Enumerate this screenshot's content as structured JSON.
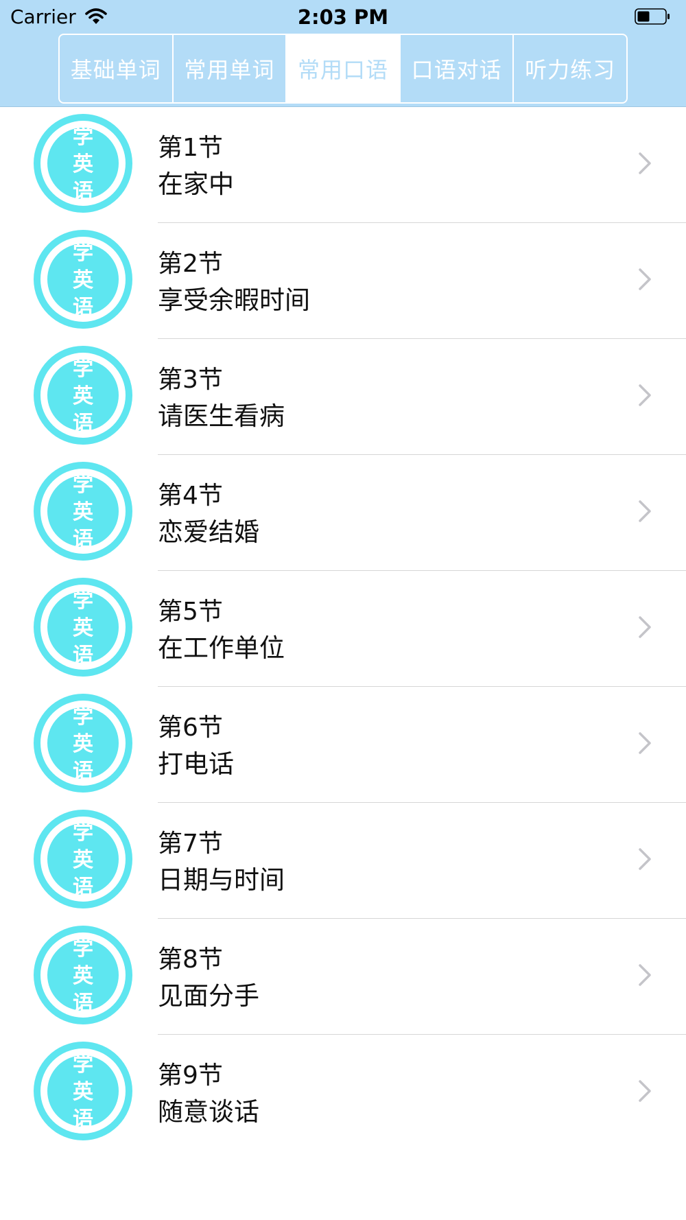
{
  "status_bar": {
    "carrier": "Carrier",
    "time": "2:03 PM"
  },
  "tabs": [
    {
      "label": "基础单词",
      "active": false
    },
    {
      "label": "常用单词",
      "active": false
    },
    {
      "label": "常用口语",
      "active": true
    },
    {
      "label": "口语对话",
      "active": false
    },
    {
      "label": "听力练习",
      "active": false
    }
  ],
  "badge_text": [
    "学",
    "英",
    "语"
  ],
  "lessons": [
    {
      "title": "第1节",
      "subtitle": "在家中"
    },
    {
      "title": "第2节",
      "subtitle": "享受余暇时间"
    },
    {
      "title": "第3节",
      "subtitle": "请医生看病"
    },
    {
      "title": "第4节",
      "subtitle": "恋爱结婚"
    },
    {
      "title": "第5节",
      "subtitle": "在工作单位"
    },
    {
      "title": "第6节",
      "subtitle": "打电话"
    },
    {
      "title": "第7节",
      "subtitle": "日期与时间"
    },
    {
      "title": "第8节",
      "subtitle": "见面分手"
    },
    {
      "title": "第9节",
      "subtitle": "随意谈话"
    }
  ],
  "colors": {
    "header_bg": "#b3dcf7",
    "badge_ring": "#5ee6f0",
    "badge_fill": "#5ee6f0",
    "badge_text": "#ffffff"
  }
}
